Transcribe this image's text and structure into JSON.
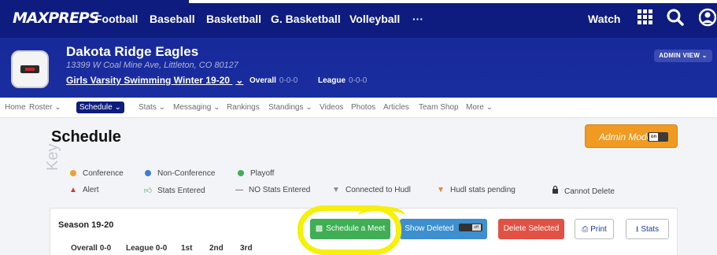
{
  "topnav": {
    "logo": "MAXPREPS",
    "links": [
      "Football",
      "Baseball",
      "Basketball",
      "G. Basketball",
      "Volleyball",
      "···"
    ],
    "watch": "Watch",
    "icons": [
      "grid-icon",
      "search-icon",
      "user-icon"
    ]
  },
  "team": {
    "name": "Dakota Ridge Eagles",
    "address": "13399 W Coal Mine Ave, Littleton, CO 80127",
    "sport": "Girls Varsity Swimming Winter 19-20",
    "overall_label": "Overall",
    "overall_value": "0-0-0",
    "league_label": "League",
    "league_value": "0-0-0",
    "admin_view": "ADMIN VIEW"
  },
  "subnav": {
    "items": [
      "Home",
      "Roster",
      "Schedule",
      "Stats",
      "Messaging",
      "Rankings",
      "Standings",
      "Videos",
      "Photos",
      "Articles",
      "Team Shop",
      "More"
    ],
    "active": "Schedule"
  },
  "page": {
    "title": "Schedule",
    "admin_mode": "Admin Mode",
    "admin_toggle": "on"
  },
  "key": {
    "label": "Key",
    "items": [
      {
        "icon": "dot",
        "color": "#f0a030",
        "label": "Conference"
      },
      {
        "icon": "dot",
        "color": "#3a7fd0",
        "label": "Non-Conference"
      },
      {
        "icon": "dot",
        "color": "#3fae55",
        "label": "Playoff"
      },
      {
        "icon": "alert-icon",
        "color": "#d9342b",
        "label": "Alert"
      },
      {
        "icon": "thumbs-up-icon",
        "color": "#3fae55",
        "label": "Stats Entered"
      },
      {
        "icon": "dash-icon",
        "color": "#333333",
        "label": "NO Stats Entered"
      },
      {
        "icon": "hudl-icon",
        "color": "#888888",
        "label": "Connected to Hudl"
      },
      {
        "icon": "hudl-icon",
        "color": "#f08020",
        "label": "Hudl stats pending"
      },
      {
        "icon": "lock-icon",
        "color": "#333333",
        "label": "Cannot Delete"
      }
    ]
  },
  "season": {
    "label": "Season 19-20",
    "overall_label": "Overall",
    "overall_value": "0-0",
    "league_label": "League",
    "league_value": "0-0",
    "places": [
      "1st",
      "2nd",
      "3rd"
    ],
    "buttons": {
      "schedule_meet": "Schedule a Meet",
      "show_deleted": "Show Deleted",
      "show_deleted_toggle": "off",
      "delete_selected": "Delete Selected",
      "print": "Print",
      "stats": "Stats"
    }
  },
  "colors": {
    "nav_bg": "#0d1c7e",
    "header_bg": "#1a2d9f",
    "admin_orange": "#f09a22",
    "meet_green": "#3fae55",
    "deleted_blue": "#3d8fd0",
    "delete_red": "#e15244",
    "highlight_yellow": "#f6f00a"
  }
}
